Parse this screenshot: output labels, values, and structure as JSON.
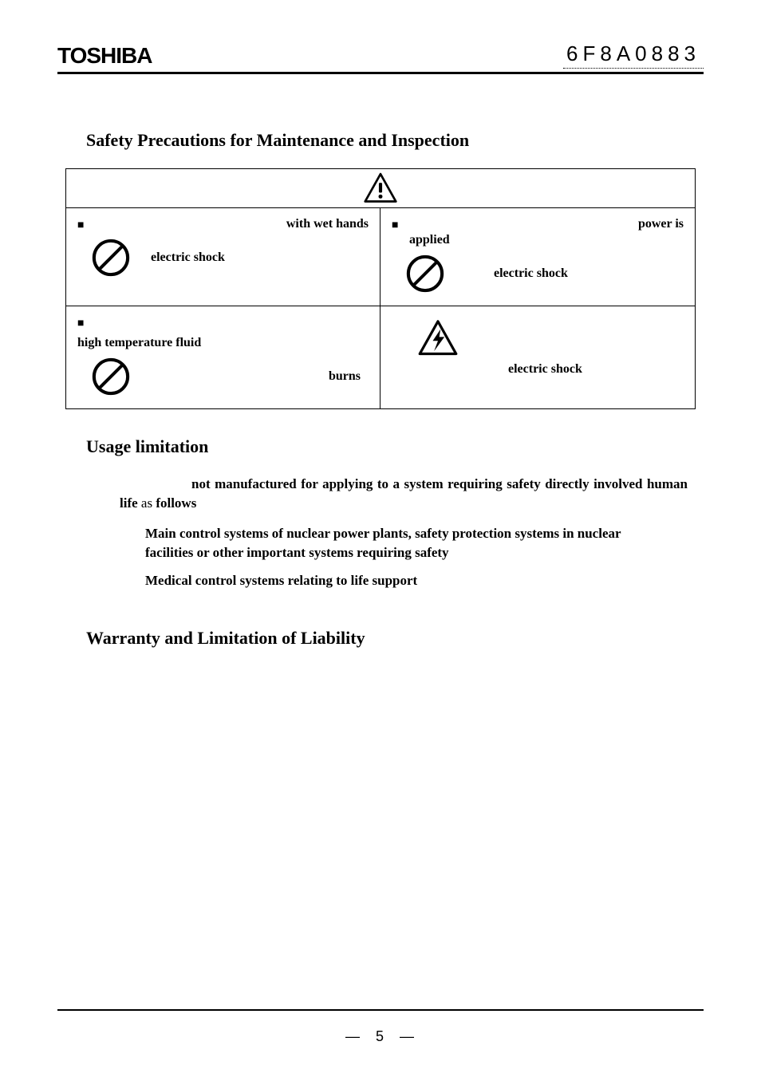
{
  "header": {
    "brand": "TOSHIBA",
    "doc_code": "6F8A0883"
  },
  "section1": {
    "title": "Safety Precautions for Maintenance and Inspection",
    "cells": {
      "top_left": {
        "line_text": "with wet hands",
        "icon_label": "electric shock"
      },
      "top_right": {
        "line_text_1": "power is",
        "line_text_2": "applied",
        "icon_label": "electric shock"
      },
      "bottom_left": {
        "line_text": "high temperature fluid",
        "icon_label": "burns"
      },
      "bottom_right": {
        "icon_label": "electric shock"
      }
    }
  },
  "section2": {
    "title": "Usage limitation",
    "para_bold_1": "not manufactured for applying to a system requiring safety directly involved human life",
    "para_plain_1": " as ",
    "para_bold_2": "follows",
    "items": [
      "Main control systems of nuclear power plants, safety protection systems in nuclear facilities or other important systems requiring safety",
      "Medical control systems relating to life support"
    ]
  },
  "section3": {
    "title": "Warranty and Limitation of Liability"
  },
  "footer": {
    "left_dash": "—",
    "page": "5",
    "right_dash": "—"
  }
}
